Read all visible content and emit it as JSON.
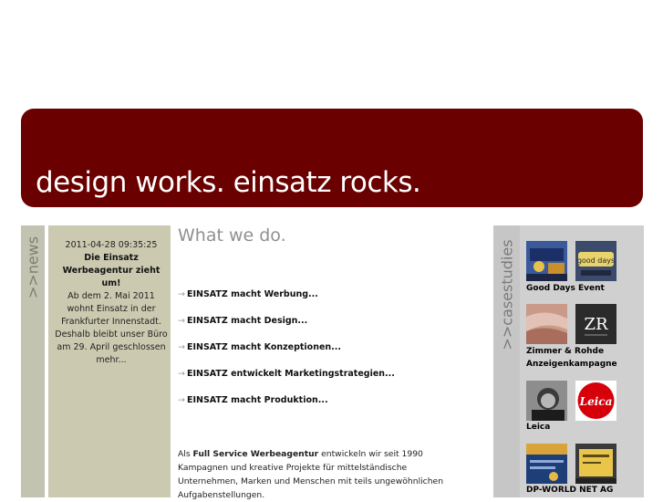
{
  "banner": {
    "title": "design works. einsatz rocks."
  },
  "news": {
    "tab_label": ">>news",
    "date": "2011-04-28 09:35:25",
    "headline": "Die Einsatz Werbeagentur zieht um!",
    "body": "Ab dem 2. Mai 2011 wohnt Einsatz in der Frankfurter Innenstadt. Deshalb bleibt unser Büro am 29. April geschlossen mehr..."
  },
  "main": {
    "heading": "What we do.",
    "services": [
      "EINSATZ macht Werbung...",
      "EINSATZ macht Design...",
      "EINSATZ macht Konzeptionen...",
      "EINSATZ entwickelt Marketingstrategien...",
      "EINSATZ macht Produktion..."
    ],
    "arrow_glyph": "→",
    "intro_prefix": "Als",
    "intro_bold": "Full Service Werbeagentur",
    "intro_rest": "entwickeln wir seit 1990 Kampagnen und kreative Projekte für mittelständische Unternehmen, Marken und Menschen mit teils ungewöhnlichen Aufgabenstellungen."
  },
  "casestudies": {
    "tab_label": ">>casestudies",
    "items": [
      {
        "title": "Good Days Event",
        "thumb2_text": "good days"
      },
      {
        "title_line1": "Zimmer & Rohde",
        "title_line2": "Anzeigenkampagne",
        "thumb2_text": "ZR"
      },
      {
        "title": "Leica",
        "thumb2_text": "Leica"
      },
      {
        "title": "DP-WORLD NET AG"
      }
    ]
  }
}
